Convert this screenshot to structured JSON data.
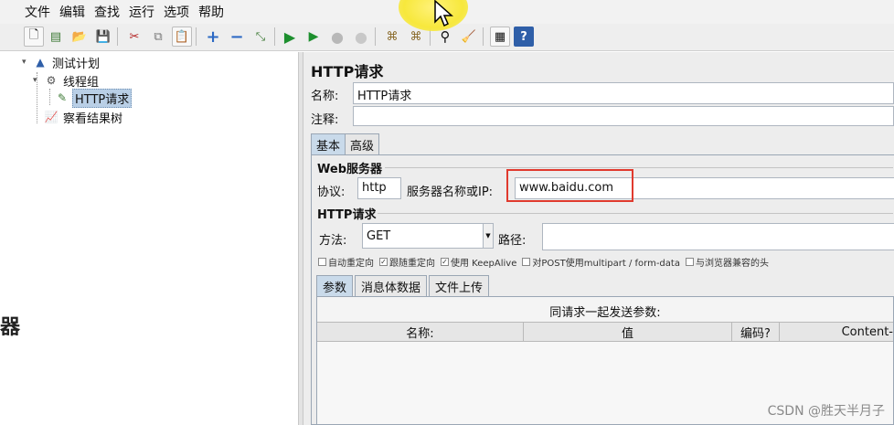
{
  "menu": [
    "文件",
    "编辑",
    "查找",
    "运行",
    "选项",
    "帮助"
  ],
  "toolbar": {
    "buttons": [
      {
        "name": "new-icon",
        "glyph": "🗋"
      },
      {
        "name": "templates-icon",
        "glyph": "▤"
      },
      {
        "name": "open-icon",
        "glyph": "📂"
      },
      {
        "name": "save-icon",
        "glyph": "💾"
      },
      {
        "name": "cut-icon",
        "glyph": "✂"
      },
      {
        "name": "copy-icon",
        "glyph": "⧉"
      },
      {
        "name": "paste-icon",
        "glyph": "📋"
      },
      {
        "name": "expand-icon",
        "glyph": "+"
      },
      {
        "name": "collapse-icon",
        "glyph": "−"
      },
      {
        "name": "toggle-icon",
        "glyph": "⤡"
      },
      {
        "name": "start-icon",
        "glyph": "▶"
      },
      {
        "name": "start-no-pauses-icon",
        "glyph": "▶"
      },
      {
        "name": "stop-icon",
        "glyph": "●"
      },
      {
        "name": "shutdown-icon",
        "glyph": "●"
      },
      {
        "name": "clear-icon",
        "glyph": "⌘"
      },
      {
        "name": "clear-all-icon",
        "glyph": "⌘"
      },
      {
        "name": "search-icon",
        "glyph": "⚲"
      },
      {
        "name": "reset-search-icon",
        "glyph": "🧹"
      },
      {
        "name": "function-helper-icon",
        "glyph": "▦"
      },
      {
        "name": "help-icon",
        "glyph": "?"
      }
    ]
  },
  "tree": {
    "test_plan": "测试计划",
    "thread_group": "线程组",
    "http_request": "HTTP请求",
    "results_tree": "察看结果树"
  },
  "stray_char": "器",
  "panel": {
    "title": "HTTP请求",
    "name_label": "名称:",
    "name_value": "HTTP请求",
    "comment_label": "注释:",
    "comment_value": "",
    "tabs": [
      "基本",
      "高级"
    ],
    "web_server_title": "Web服务器",
    "protocol_label": "协议:",
    "protocol_value": "http",
    "server_label": "服务器名称或IP:",
    "server_value": "www.baidu.com",
    "http_request_title": "HTTP请求",
    "method_label": "方法:",
    "method_value": "GET",
    "path_label": "路径:",
    "path_value": "",
    "checkboxes": [
      {
        "label": "自动重定向",
        "checked": false
      },
      {
        "label": "跟随重定向",
        "checked": true
      },
      {
        "label": "使用 KeepAlive",
        "checked": true
      },
      {
        "label": "对POST使用multipart / form-data",
        "checked": false
      },
      {
        "label": "与浏览器兼容的头",
        "checked": false
      }
    ],
    "subtabs": [
      "参数",
      "消息体数据",
      "文件上传"
    ],
    "params_title": "同请求一起发送参数:",
    "columns": [
      "名称:",
      "值",
      "编码?",
      "Content-"
    ]
  },
  "watermark": "CSDN @胜天半月子",
  "colors": {
    "highlight_box": "#e03a2e",
    "selected_tree": "#b9cfe6",
    "cursor_halo": "#f7e83c"
  }
}
